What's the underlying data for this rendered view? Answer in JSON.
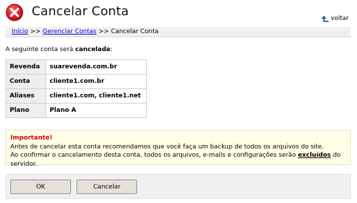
{
  "header": {
    "title": "Cancelar Conta",
    "back_label": "voltar",
    "icon": "cancel-x-icon",
    "accent_color": "#d92020"
  },
  "breadcrumb": {
    "items": [
      "Início",
      "Gerenciar Contas",
      "Cancelar Conta"
    ],
    "separator": ">>"
  },
  "intro": {
    "text": "A seguinte conta será ",
    "emphasis": "cancelada",
    "suffix": ":"
  },
  "details": [
    {
      "label": "Revenda",
      "value": "suarevenda.com.br"
    },
    {
      "label": "Conta",
      "value": "cliente1.com.br"
    },
    {
      "label": "Aliases",
      "value": "cliente1.com, cliente1.net"
    },
    {
      "label": "Plano",
      "value": "Plano A"
    }
  ],
  "warning": {
    "title": "Importante!",
    "line1": "Antes de cancelar esta conta recomendamos que você faça um backup de todos os arquivos do site.",
    "line2_before": "Ao confirmar o cancelamento desta conta, todos os arquivos, e-mails e configurações serão ",
    "line2_strong": "excluídos",
    "line2_after": " do servidor."
  },
  "actions": {
    "ok_label": "OK",
    "cancel_label": "Cancelar"
  }
}
